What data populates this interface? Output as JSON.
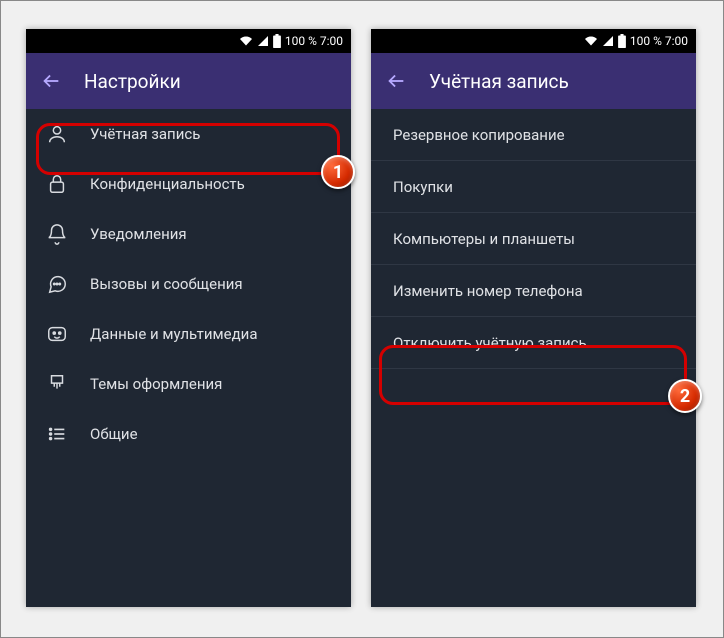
{
  "status": {
    "battery_text": "100 % 7:00"
  },
  "left": {
    "title": "Настройки",
    "items": [
      {
        "label": "Учётная запись"
      },
      {
        "label": "Конфиденциальность"
      },
      {
        "label": "Уведомления"
      },
      {
        "label": "Вызовы и сообщения"
      },
      {
        "label": "Данные и мультимедиа"
      },
      {
        "label": "Темы оформления"
      },
      {
        "label": "Общие"
      }
    ]
  },
  "right": {
    "title": "Учётная запись",
    "items": [
      {
        "label": "Резервное копирование"
      },
      {
        "label": "Покупки"
      },
      {
        "label": "Компьютеры и планшеты"
      },
      {
        "label": "Изменить номер телефона"
      },
      {
        "label": "Отключить учётную запись"
      }
    ]
  },
  "badges": {
    "one": "1",
    "two": "2"
  }
}
